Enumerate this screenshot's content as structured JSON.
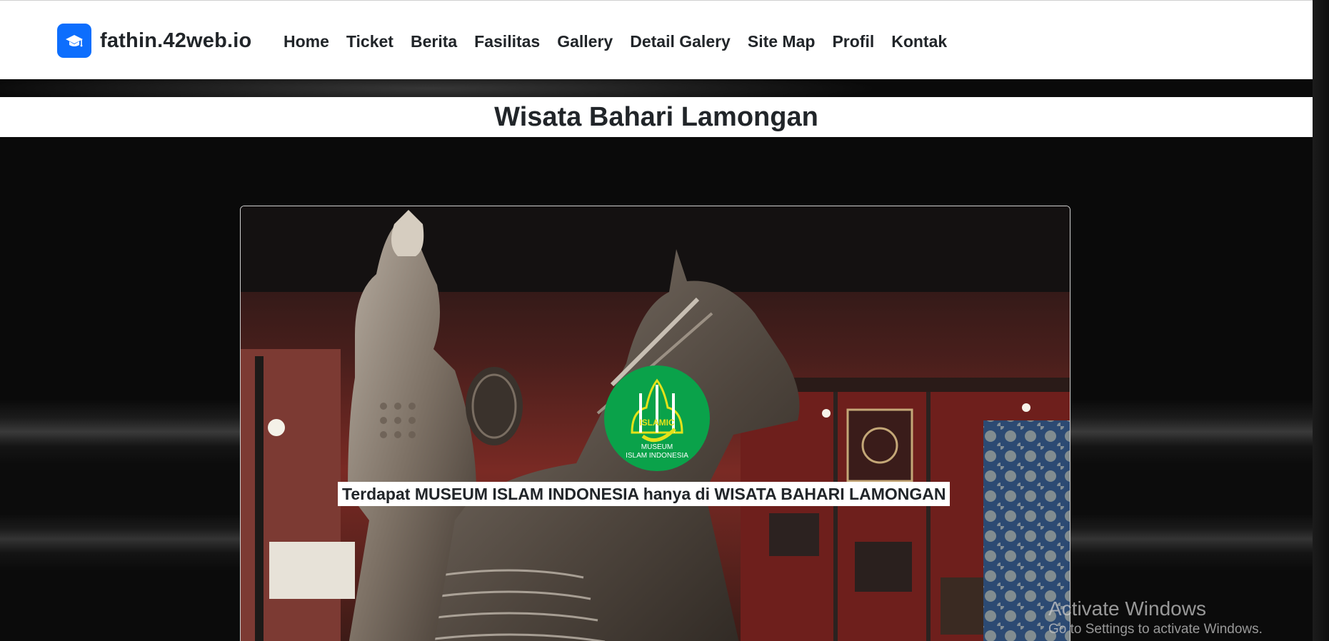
{
  "navbar": {
    "brand": "fathin.42web.io",
    "brand_icon": "graduation-cap-icon",
    "brand_color": "#0d6efd",
    "links": [
      "Home",
      "Ticket",
      "Berita",
      "Fasilitas",
      "Gallery",
      "Detail Galery",
      "Site Map",
      "Profil",
      "Kontak"
    ]
  },
  "page": {
    "title": "Wisata Bahari Lamongan"
  },
  "hero": {
    "caption": "Terdapat MUSEUM ISLAM INDONESIA hanya di WISATA BAHARI LAMONGAN",
    "logo": {
      "top_text": "ISLAMIC",
      "mid_text": "MUSEUM",
      "bottom_text": "ISLAM INDONESIA",
      "color": "#0aa24a"
    }
  },
  "watermark": {
    "title": "Activate Windows",
    "subtitle": "Go to Settings to activate Windows."
  }
}
